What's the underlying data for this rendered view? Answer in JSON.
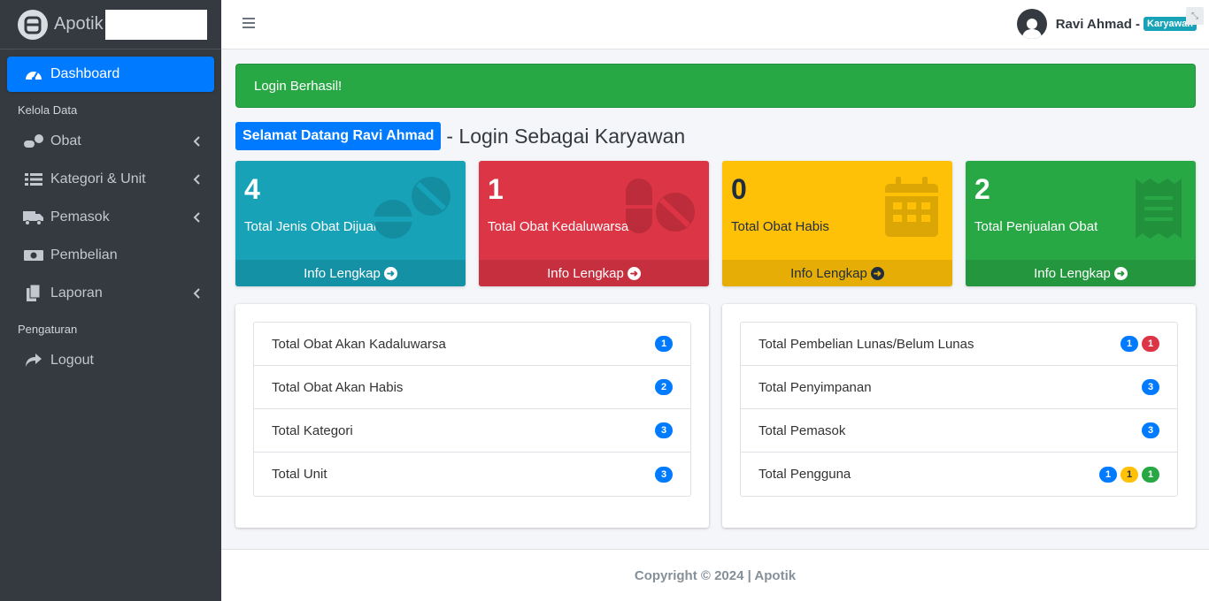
{
  "brand": {
    "name": "Apotik"
  },
  "sidebar": {
    "items": [
      {
        "label": "Dashboard",
        "icon": "tachometer-icon"
      },
      {
        "label": "Obat",
        "icon": "pills-icon"
      },
      {
        "label": "Kategori & Unit",
        "icon": "list-icon"
      },
      {
        "label": "Pemasok",
        "icon": "truck-icon"
      },
      {
        "label": "Pembelian",
        "icon": "money-icon"
      },
      {
        "label": "Laporan",
        "icon": "copy-icon"
      },
      {
        "label": "Logout",
        "icon": "share-icon"
      }
    ],
    "headers": {
      "kelola": "Kelola Data",
      "pengaturan": "Pengaturan"
    }
  },
  "topbar": {
    "user_name": "Ravi Ahmad -",
    "role": "Karyawan"
  },
  "alert": {
    "text": "Login Berhasil!"
  },
  "welcome": {
    "badge": "Selamat Datang Ravi Ahmad",
    "text": "- Login Sebagai Karyawan"
  },
  "boxes": [
    {
      "value": "4",
      "label": "Total Jenis Obat Dijual",
      "footer": "Info Lengkap",
      "color": "#17a2b8"
    },
    {
      "value": "1",
      "label": "Total Obat Kedaluwarsa",
      "footer": "Info Lengkap",
      "color": "#dc3545"
    },
    {
      "value": "0",
      "label": "Total Obat Habis",
      "footer": "Info Lengkap",
      "color": "#ffc107"
    },
    {
      "value": "2",
      "label": "Total Penjualan Obat",
      "footer": "Info Lengkap",
      "color": "#28a745"
    }
  ],
  "left_list": [
    {
      "label": "Total Obat Akan Kadaluwarsa",
      "badges": [
        "1"
      ]
    },
    {
      "label": "Total Obat Akan Habis",
      "badges": [
        "2"
      ]
    },
    {
      "label": "Total Kategori",
      "badges": [
        "3"
      ]
    },
    {
      "label": "Total Unit",
      "badges": [
        "3"
      ]
    }
  ],
  "right_list": [
    {
      "label": "Total Pembelian Lunas/Belum Lunas",
      "badges": [
        "1",
        "1"
      ]
    },
    {
      "label": "Total Penyimpanan",
      "badges": [
        "3"
      ]
    },
    {
      "label": "Total Pemasok",
      "badges": [
        "3"
      ]
    },
    {
      "label": "Total Pengguna",
      "badges": [
        "1",
        "1",
        "1"
      ]
    }
  ],
  "footer": {
    "text": "Copyright © 2024 | Apotik"
  }
}
